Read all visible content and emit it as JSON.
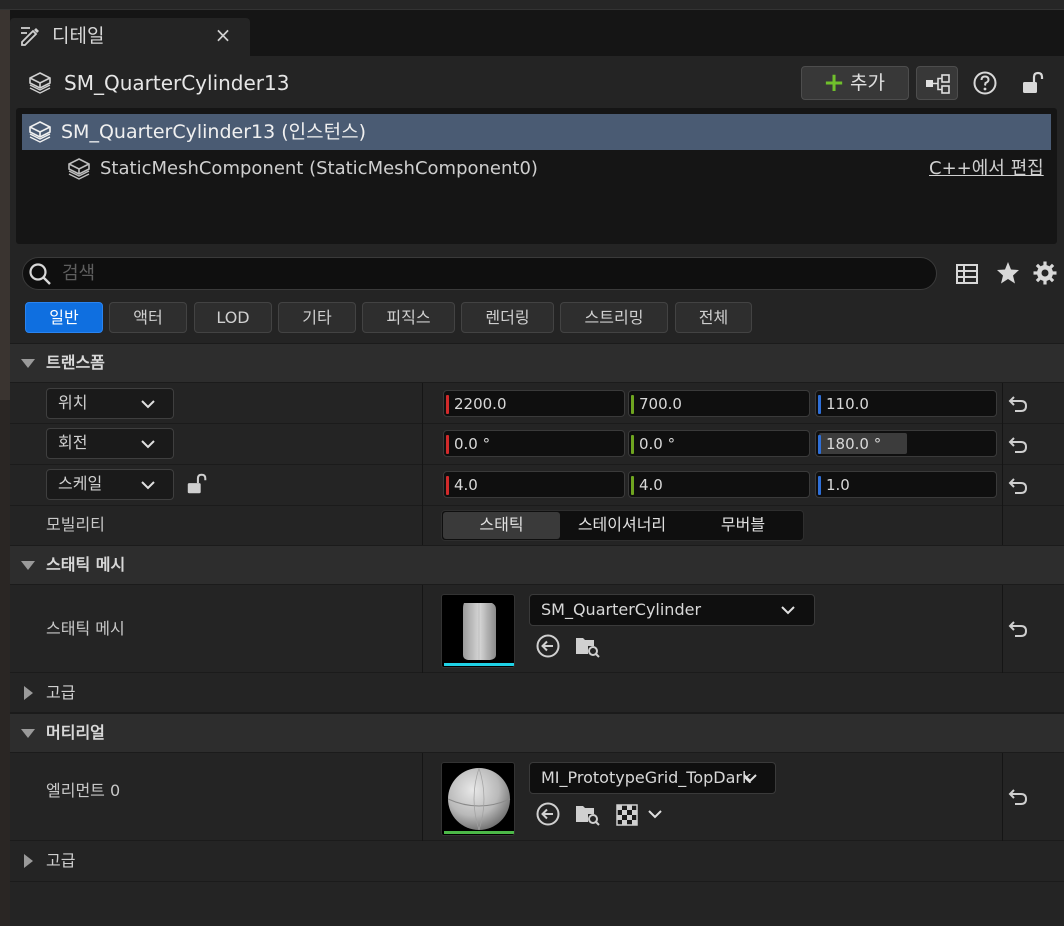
{
  "tab": {
    "title": "디테일",
    "close": "×"
  },
  "actor": {
    "name": "SM_QuarterCylinder13"
  },
  "toolbar": {
    "add_label": "추가"
  },
  "tree": {
    "root_label": "SM_QuarterCylinder13 (인스턴스)",
    "child_label": "StaticMeshComponent (StaticMeshComponent0)",
    "edit_link": "C++에서 편집"
  },
  "search": {
    "placeholder": "검색",
    "value": ""
  },
  "filter_tabs": [
    "일반",
    "액터",
    "LOD",
    "기타",
    "피직스",
    "렌더링",
    "스트리밍",
    "전체"
  ],
  "transform": {
    "title": "트랜스폼",
    "location": {
      "label": "위치",
      "x": "2200.0",
      "y": "700.0",
      "z": "110.0"
    },
    "rotation": {
      "label": "회전",
      "x": "0.0 °",
      "y": "0.0 °",
      "z": "180.0 °",
      "z_fill": 0.5
    },
    "scale": {
      "label": "스케일",
      "x": "4.0",
      "y": "4.0",
      "z": "1.0"
    },
    "mobility": {
      "label": "모빌리티",
      "options": [
        "스태틱",
        "스테이셔너리",
        "무버블"
      ],
      "selected": "스태틱"
    }
  },
  "static_mesh": {
    "title": "스태틱 메시",
    "row_label": "스태틱 메시",
    "asset": "SM_QuarterCylinder",
    "advanced": "고급"
  },
  "materials": {
    "title": "머티리얼",
    "row_label": "엘리먼트 0",
    "asset": "MI_PrototypeGrid_TopDark",
    "advanced": "고급"
  },
  "colors": {
    "x_axis": "#d12a2a",
    "y_axis": "#6fa520",
    "z_axis": "#2e6fd8",
    "active_tab": "#0f6fe0",
    "selected_row": "#4a5b73",
    "add_plus": "#70c02c",
    "mesh_thumb_line": "#1fd1e6",
    "material_thumb_line": "#4cb848"
  }
}
